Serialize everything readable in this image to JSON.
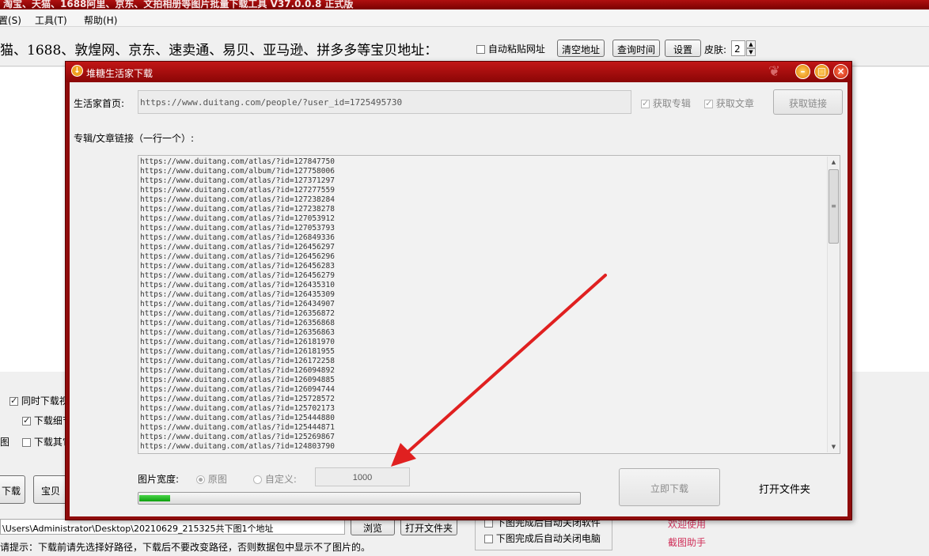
{
  "main": {
    "title": "淘宝、天猫、1688阿里、京东、文拍相册等图片批量下载工具 V37.0.0.8 正式版",
    "menu": [
      "置(S)",
      "工具(T)",
      "帮助(H)"
    ],
    "url_prompt": "猫、1688、敦煌网、京东、速卖通、易贝、亚马逊、拼多多等宝贝地址：",
    "auto_paste": "自动粘贴网址",
    "clear_btn": "清空地址",
    "query_btn": "查询时间",
    "settings_btn": "设置",
    "skin_label": "皮肤:",
    "skin_value": "2",
    "opt1": "同时下载视",
    "opt2": "下载细节",
    "opt3": "下载其它",
    "opt3_prefix": "图",
    "download_btn": "下载",
    "baby_btn": "宝贝",
    "path": "\\Users\\Administrator\\Desktop\\20210629_215325共下图1个地址",
    "browse_btn": "浏览",
    "open_folder_btn": "打开文件夹",
    "hint": "请提示：下载前请先选择好路径，下载后不要改变路径，否则数据包中显示不了图片的。",
    "close_soft": "下图完成后自动关闭软件",
    "close_pc": "下图完成后自动关闭电脑",
    "welcome": "欢迎使用",
    "screenshot_helper": "截图助手"
  },
  "dialog": {
    "title": "堆糖生活家下载",
    "home_label": "生活家首页:",
    "home_value": "https://www.duitang.com/people/?user_id=1725495730",
    "get_albums": "获取专辑",
    "get_articles": "获取文章",
    "get_links_btn": "获取链接",
    "links_label": "专辑/文章链接（一行一个）:",
    "links": [
      "https://www.duitang.com/atlas/?id=127847750",
      "https://www.duitang.com/album/?id=127758006",
      "https://www.duitang.com/atlas/?id=127371297",
      "https://www.duitang.com/atlas/?id=127277559",
      "https://www.duitang.com/atlas/?id=127238284",
      "https://www.duitang.com/atlas/?id=127238278",
      "https://www.duitang.com/atlas/?id=127053912",
      "https://www.duitang.com/atlas/?id=127053793",
      "https://www.duitang.com/atlas/?id=126849336",
      "https://www.duitang.com/atlas/?id=126456297",
      "https://www.duitang.com/atlas/?id=126456296",
      "https://www.duitang.com/atlas/?id=126456283",
      "https://www.duitang.com/atlas/?id=126456279",
      "https://www.duitang.com/atlas/?id=126435310",
      "https://www.duitang.com/atlas/?id=126435309",
      "https://www.duitang.com/atlas/?id=126434907",
      "https://www.duitang.com/atlas/?id=126356872",
      "https://www.duitang.com/atlas/?id=126356868",
      "https://www.duitang.com/atlas/?id=126356863",
      "https://www.duitang.com/atlas/?id=126181970",
      "https://www.duitang.com/atlas/?id=126181955",
      "https://www.duitang.com/atlas/?id=126172258",
      "https://www.duitang.com/atlas/?id=126094892",
      "https://www.duitang.com/atlas/?id=126094885",
      "https://www.duitang.com/atlas/?id=126094744",
      "https://www.duitang.com/atlas/?id=125728572",
      "https://www.duitang.com/atlas/?id=125702173",
      "https://www.duitang.com/atlas/?id=125444880",
      "https://www.duitang.com/atlas/?id=125444871",
      "https://www.duitang.com/atlas/?id=125269867",
      "https://www.duitang.com/atlas/?id=124803790"
    ],
    "width_label": "图片宽度:",
    "original": "原图",
    "custom": "自定义:",
    "custom_value": "1000",
    "download_now_btn": "立即下载",
    "open_folder_btn": "打开文件夹",
    "progress_fraction": 0.07
  },
  "colors": {
    "title_red": "#8f0b0b",
    "progress_green": "#0ea00e",
    "arrow_red": "#e02020",
    "link_pink": "#d0305a"
  }
}
